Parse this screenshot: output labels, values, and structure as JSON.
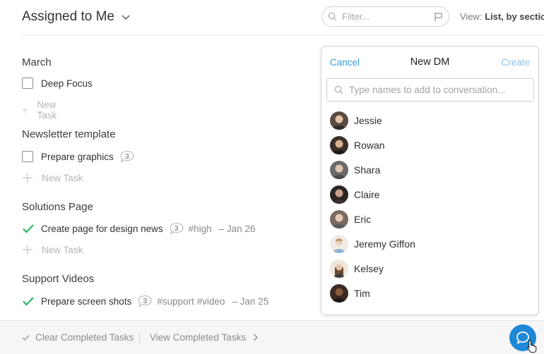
{
  "header": {
    "title": "Assigned to Me",
    "filter_placeholder": "Filter...",
    "view_prefix": "View:",
    "view_value": "List, by section"
  },
  "sections": [
    {
      "title": "March",
      "tasks": [
        {
          "name": "Deep Focus",
          "completed": false
        }
      ],
      "new_task": "New Task"
    },
    {
      "title": "Newsletter template",
      "tasks": [
        {
          "name": "Prepare graphics",
          "completed": false,
          "comments": "3"
        }
      ],
      "new_task": "New Task"
    },
    {
      "title": "Solutions Page",
      "tasks": [
        {
          "name": "Create page for design news",
          "completed": true,
          "comments": "3",
          "tags": "#high",
          "date": "– Jan 26"
        }
      ],
      "new_task": "New Task"
    },
    {
      "title": "Support Videos",
      "tasks": [
        {
          "name": "Prepare screen shots",
          "completed": true,
          "comments": "3",
          "tags": "#support #video",
          "date": "– Jan 25"
        }
      ]
    }
  ],
  "bottom_bar": {
    "clear_label": "Clear Completed Tasks",
    "view_label": "View Completed Tasks"
  },
  "dm": {
    "cancel": "Cancel",
    "title": "New DM",
    "create": "Create",
    "search_placeholder": "Type names to add to conversation...",
    "people": [
      {
        "name": "Jessie",
        "avatar_color": "#5a4a42"
      },
      {
        "name": "Rowan",
        "avatar_color": "#3b2f2a"
      },
      {
        "name": "Shara",
        "avatar_color": "#6a6a6a"
      },
      {
        "name": "Claire",
        "avatar_color": "#2b2523"
      },
      {
        "name": "Eric",
        "avatar_color": "#7a6a60"
      },
      {
        "name": "Jeremy Giffon",
        "avatar_color": "#d8c8b8"
      },
      {
        "name": "Kelsey",
        "avatar_color": "#8a6a50"
      },
      {
        "name": "Tim",
        "avatar_color": "#3a2a22"
      }
    ]
  },
  "colors": {
    "accent": "#1f88d8",
    "link": "#3a9ce0",
    "check": "#2fb866"
  }
}
